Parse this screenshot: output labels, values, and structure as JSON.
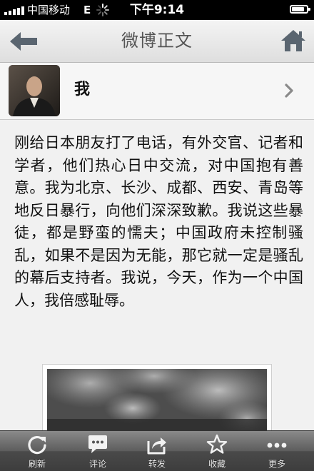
{
  "status_bar": {
    "carrier": "中国移动",
    "network": "E",
    "time": "下午9:14",
    "battery_level": 0.85
  },
  "nav": {
    "title": "微博正文",
    "back_icon": "back-arrow-icon",
    "home_icon": "home-icon"
  },
  "author": {
    "name": "我"
  },
  "post": {
    "text": "刚给日本朋友打了电话，有外交官、记者和学者，他们热心日中交流，对中国抱有善意。我为北京、长沙、成都、西安、青岛等地反日暴行，向他们深深致歉。我说这些暴徒，都是野蛮的懦夫；中国政府未控制骚乱，如果不是因为无能，那它就一定是骚乱的幕后支持者。我说，今天，作为一个中国人，我倍感耻辱。"
  },
  "tabs": [
    {
      "label": "刷新",
      "icon": "refresh-icon"
    },
    {
      "label": "评论",
      "icon": "comment-icon"
    },
    {
      "label": "转发",
      "icon": "share-icon"
    },
    {
      "label": "收藏",
      "icon": "star-icon"
    },
    {
      "label": "更多",
      "icon": "more-icon"
    }
  ],
  "colors": {
    "background": "#f1f1f1",
    "status_bar": "#000000",
    "tab_bar": "#4a4a4a",
    "nav_icon": "#5a6570"
  }
}
